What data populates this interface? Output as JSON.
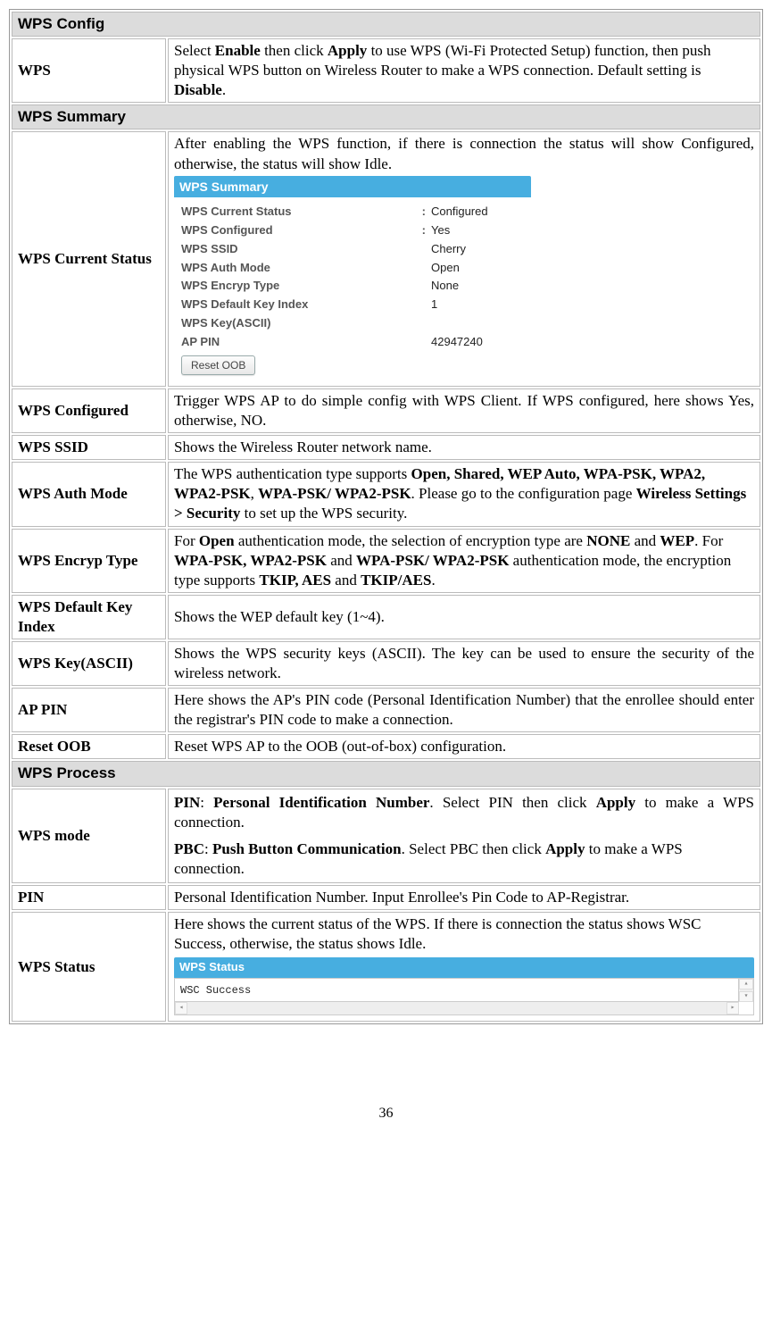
{
  "sections": {
    "config_header": "WPS Config",
    "summary_header": "WPS Summary",
    "process_header": "WPS Process"
  },
  "wps_config": {
    "label": "WPS",
    "desc_prefix": "Select ",
    "desc_enable": "Enable",
    "desc_mid1": " then click ",
    "desc_apply": "Apply",
    "desc_mid2": " to use WPS (Wi-Fi Protected Setup) function, then push physical WPS button on Wireless  Router to make a WPS connection. Default setting is ",
    "desc_disable": "Disable",
    "desc_end": "."
  },
  "current_status": {
    "label": "WPS Current Status",
    "intro": "After enabling the WPS function, if there is connection the status will show Configured, otherwise, the status will show Idle.",
    "panel_title": "WPS Summary",
    "rows": [
      {
        "label": "WPS Current Status",
        "value": "Configured",
        "colon": true
      },
      {
        "label": "WPS Configured",
        "value": "Yes",
        "colon": true
      },
      {
        "label": "WPS SSID",
        "value": "Cherry",
        "colon": false
      },
      {
        "label": "WPS Auth Mode",
        "value": "Open",
        "colon": false
      },
      {
        "label": "WPS Encryp Type",
        "value": "None",
        "colon": false
      },
      {
        "label": "WPS Default Key Index",
        "value": "1",
        "colon": false
      },
      {
        "label": "WPS Key(ASCII)",
        "value": "",
        "colon": false
      },
      {
        "label": "AP PIN",
        "value": "42947240",
        "colon": false
      }
    ],
    "reset_button": "Reset OOB"
  },
  "rows": {
    "wps_configured": {
      "label": "WPS Configured",
      "desc": "Trigger WPS AP to do simple config with WPS Client. If WPS configured, here shows Yes, otherwise, NO."
    },
    "wps_ssid": {
      "label": "WPS SSID",
      "desc": "Shows the Wireless  Router network name."
    },
    "wps_auth_mode": {
      "label": "WPS Auth Mode",
      "pre": "The WPS authentication type supports ",
      "bold1": "Open, Shared, WEP Auto, WPA-PSK, WPA2, WPA2-PSK",
      "mid1": ", ",
      "bold2": "WPA-PSK/ WPA2-PSK",
      "mid2": ". Please go to the configuration page ",
      "bold3": "Wireless Settings > Security",
      "post": " to set up the WPS security."
    },
    "wps_encryp_type": {
      "label": "WPS Encryp Type",
      "pre": "For ",
      "bold1": "Open",
      "mid1": " authentication mode, the selection of encryption type are ",
      "bold2": "NONE",
      "mid2": " and ",
      "bold3": "WEP",
      "mid3": ". For ",
      "bold4": "WPA-PSK, WPA2-PSK",
      "mid4": " and ",
      "bold5": "WPA-PSK/ WPA2-PSK",
      "mid5": " authentication mode, the encryption type supports ",
      "bold6": "TKIP, AES",
      "mid6": " and ",
      "bold7": "TKIP/AES",
      "post": "."
    },
    "wps_default_key": {
      "label": "WPS Default Key Index",
      "desc": "Shows the WEP default key (1~4)."
    },
    "wps_key_ascii": {
      "label": "WPS Key(ASCII)",
      "desc": "Shows the WPS security keys (ASCII). The key can be used to ensure the security of the wireless network."
    },
    "ap_pin": {
      "label": "AP PIN",
      "desc": "Here shows the AP's PIN code (Personal Identification Number) that the enrollee should enter the registrar's PIN code to make a connection."
    },
    "reset_oob": {
      "label": "Reset OOB",
      "desc": "Reset WPS AP to the OOB (out-of-box) configuration."
    }
  },
  "wps_mode": {
    "label": "WPS mode",
    "pin_bold1": "PIN",
    "pin_sep": ": ",
    "pin_bold2": "Personal Identification Number",
    "pin_text1": ". Select PIN then click ",
    "pin_bold3": "Apply",
    "pin_text2": " to make a WPS connection.",
    "pbc_bold1": "PBC",
    "pbc_sep": ": ",
    "pbc_bold2": "Push Button Communication",
    "pbc_text1": ". Select PBC then click ",
    "pbc_bold3": "Apply",
    "pbc_text2": " to make a WPS connection."
  },
  "pin_row": {
    "label": "PIN",
    "desc": "Personal Identification Number. Input Enrollee's Pin Code to AP-Registrar."
  },
  "wps_status": {
    "label": "WPS Status",
    "intro": "Here shows the current status of the WPS. If there is connection the status shows WSC Success, otherwise, the status shows Idle.",
    "panel_title": "WPS Status",
    "value": "WSC Success"
  },
  "page_number": "36"
}
